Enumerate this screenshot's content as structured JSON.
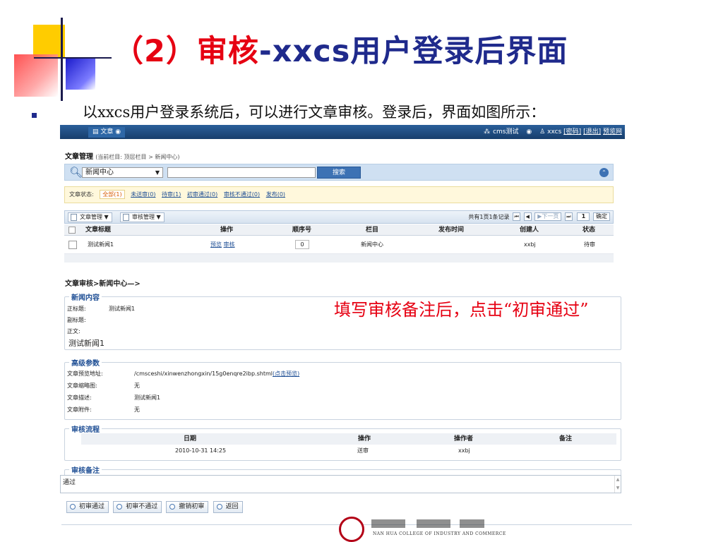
{
  "slide": {
    "title_part1": "（2）审核",
    "title_part2": "-xxcs用户登录后界面",
    "bullet_text": "以xxcs用户登录系统后，可以进行文章审核。登录后，界面如图所示：",
    "annotation": "填写审核备注后，点击“初审通过”",
    "logo_text": "NAN HUA COLLEGE OF INDUSTRY AND COMMERCE"
  },
  "colors": {
    "title_red": "#e60012",
    "title_blue": "#1f2a8c",
    "topbar": "#173e6c",
    "link": "#1f4f95"
  },
  "topbar": {
    "tab_label": "文章",
    "site_name": "cms测试",
    "user_name": "xxcs",
    "password_link": "[密码]",
    "logout_link": "[退出]",
    "preview_link": "预览网"
  },
  "breadcrumb": {
    "title": "文章管理",
    "path": "(当前栏目: 顶层栏目 > 新闻中心)"
  },
  "search": {
    "selected": "新闻中心",
    "placeholder": "",
    "button": "搜索"
  },
  "status": {
    "label": "文章状态:",
    "items": [
      "全部(1)",
      "未送审(0)",
      "待审(1)",
      "初审通过(0)",
      "审核不通过(0)",
      "发布(0)"
    ]
  },
  "toolbar": {
    "article_manage": "文章管理",
    "review_manage": "审核管理",
    "summary": "共有1页1条记录",
    "first": "⏮",
    "prev": "◀",
    "next": "▶下一页",
    "last": "⏭",
    "page": "1",
    "go": "确定"
  },
  "table": {
    "headers": [
      "文章标题",
      "操作",
      "顺序号",
      "栏目",
      "发布时间",
      "创建人",
      "状态"
    ],
    "rows": [
      {
        "title": "测试新闻1",
        "op_preview": "预览",
        "op_review": "审核",
        "order": "0",
        "column": "新闻中心",
        "publish_time": "",
        "creator": "xxbj",
        "status": "待审"
      }
    ]
  },
  "review": {
    "section_title": "文章审核>新闻中心—>",
    "news": {
      "legend": "新闻内容",
      "title_label": "正标题:",
      "title_value": "测试新闻1",
      "subtitle_label": "副标题:",
      "body_label": "正文:",
      "body_value": "测试新闻1"
    },
    "advanced": {
      "legend": "高级参数",
      "url_label": "文章预览地址:",
      "url_value": "/cmsceshi/xinwenzhongxin/15g0enqre2ibp.shtml",
      "url_link": "(点击预览)",
      "thumb_label": "文章缩略图:",
      "thumb_value": "无",
      "desc_label": "文章描述:",
      "desc_value": "测试新闻1",
      "attach_label": "文章附件:",
      "attach_value": "无"
    },
    "workflow": {
      "legend": "审核流程",
      "headers": [
        "日期",
        "操作",
        "操作者",
        "备注"
      ],
      "rows": [
        {
          "date": "2010-10-31 14:25",
          "action": "送审",
          "operator": "xxbj",
          "remark": ""
        }
      ]
    },
    "note": {
      "legend": "审核备注",
      "value": "通过"
    },
    "buttons": [
      "初审通过",
      "初审不通过",
      "撤销初审",
      "返回"
    ]
  }
}
